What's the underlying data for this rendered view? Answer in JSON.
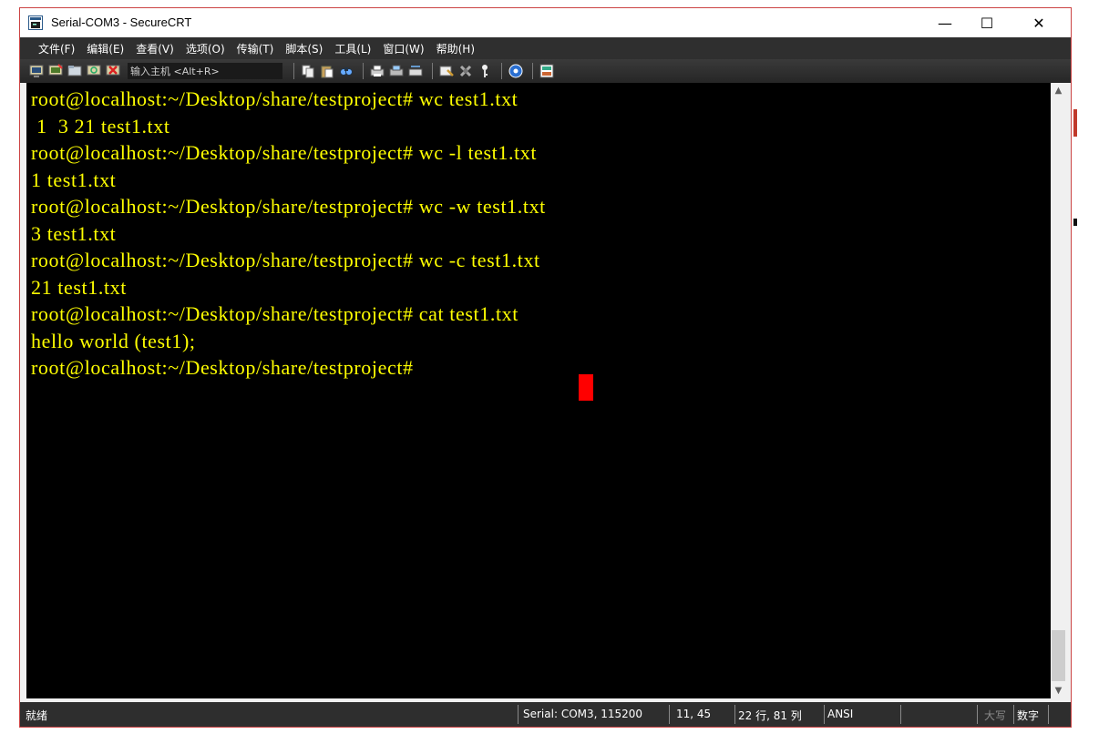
{
  "window": {
    "title": "Serial-COM3 - SecureCRT",
    "minimize_glyph": "—",
    "maximize_glyph": "☐",
    "close_glyph": "✕"
  },
  "menu": [
    "文件(F)",
    "编辑(E)",
    "查看(V)",
    "选项(O)",
    "传输(T)",
    "脚本(S)",
    "工具(L)",
    "窗口(W)",
    "帮助(H)"
  ],
  "toolbar": {
    "host_placeholder": "输入主机 <Alt+R>",
    "icons": [
      "connect-icon",
      "quick-connect-icon",
      "connect-tab-icon",
      "reconnect-icon",
      "disconnect-icon",
      "copy-icon",
      "paste-icon",
      "find-icon",
      "print-icon",
      "print-selection-icon",
      "print-setup-icon",
      "session-options-icon",
      "global-options-icon",
      "keymap-icon",
      "help-icon",
      "about-icon"
    ]
  },
  "terminal": {
    "lines": [
      "root@localhost:~/Desktop/share/testproject# wc test1.txt",
      " 1  3 21 test1.txt",
      "root@localhost:~/Desktop/share/testproject# wc -l test1.txt",
      "1 test1.txt",
      "root@localhost:~/Desktop/share/testproject# wc -w test1.txt",
      "3 test1.txt",
      "root@localhost:~/Desktop/share/testproject# wc -c test1.txt",
      "21 test1.txt",
      "root@localhost:~/Desktop/share/testproject# cat test1.txt",
      "hello world (test1);",
      "root@localhost:~/Desktop/share/testproject# "
    ],
    "text_color": "#ffff00",
    "cursor_color": "#ff0000"
  },
  "status": {
    "ready": "就绪",
    "connection": "Serial: COM3, 115200",
    "position": "11,  45",
    "size": "22 行, 81 列",
    "emulation": "ANSI",
    "caps": "大写",
    "num": "数字"
  },
  "colors": {
    "menubar_bg": "#2f2f2f",
    "terminal_bg": "#000000",
    "window_border": "#c44444"
  }
}
